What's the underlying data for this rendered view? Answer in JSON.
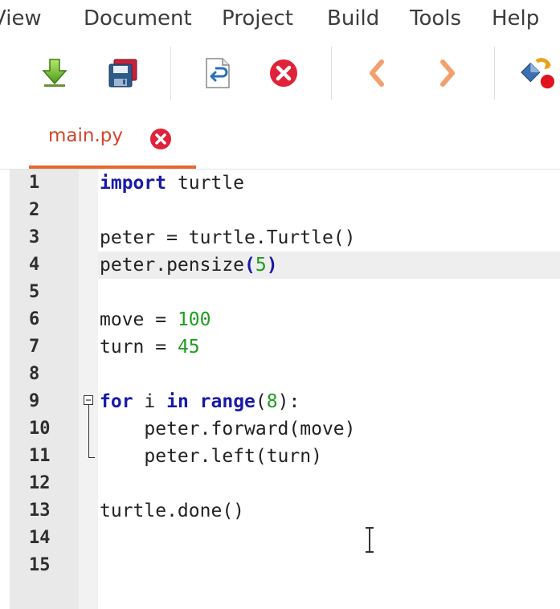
{
  "menubar": {
    "items": [
      "View",
      "Document",
      "Project",
      "Build",
      "Tools",
      "Help"
    ]
  },
  "toolbar": {
    "buttons": [
      {
        "icon": "download-arrow-icon",
        "action": "open"
      },
      {
        "icon": "save-all-icon",
        "action": "save-all"
      },
      {
        "icon": "revert-icon",
        "action": "revert"
      },
      {
        "icon": "close-icon",
        "action": "close"
      },
      {
        "icon": "chevron-left-icon",
        "action": "back"
      },
      {
        "icon": "chevron-right-icon",
        "action": "forward"
      },
      {
        "icon": "compile-icon",
        "action": "compile"
      }
    ]
  },
  "tabs": [
    {
      "label": "main.py",
      "active": true
    }
  ],
  "editor": {
    "line_numbers": [
      "1",
      "2",
      "3",
      "4",
      "5",
      "6",
      "7",
      "8",
      "9",
      "10",
      "11",
      "12",
      "13",
      "14",
      "15"
    ],
    "current_line": 4,
    "colors": {
      "keyword": "#1a1aa6",
      "number": "#1f9d1f",
      "text": "#222222",
      "gutter": "#e9e9e9",
      "tab_accent": "#e8682e",
      "tab_text": "#d3462b"
    },
    "code": {
      "l1_kw": "import",
      "l1_rest": " turtle",
      "l3": "peter = turtle.Turtle()",
      "l4_a": "peter.pensize",
      "l4_open": "(",
      "l4_num": "5",
      "l4_close": ")",
      "l6_a": "move = ",
      "l6_num": "100",
      "l7_a": "turn = ",
      "l7_num": "45",
      "l9_kw1": "for",
      "l9_a": " i ",
      "l9_kw2": "in",
      "l9_b": " ",
      "l9_kw3": "range",
      "l9_open": "(",
      "l9_num": "8",
      "l9_close": "):",
      "l10": "    peter.forward(move)",
      "l11": "    peter.left(turn)",
      "l13": "turtle.done()"
    }
  }
}
